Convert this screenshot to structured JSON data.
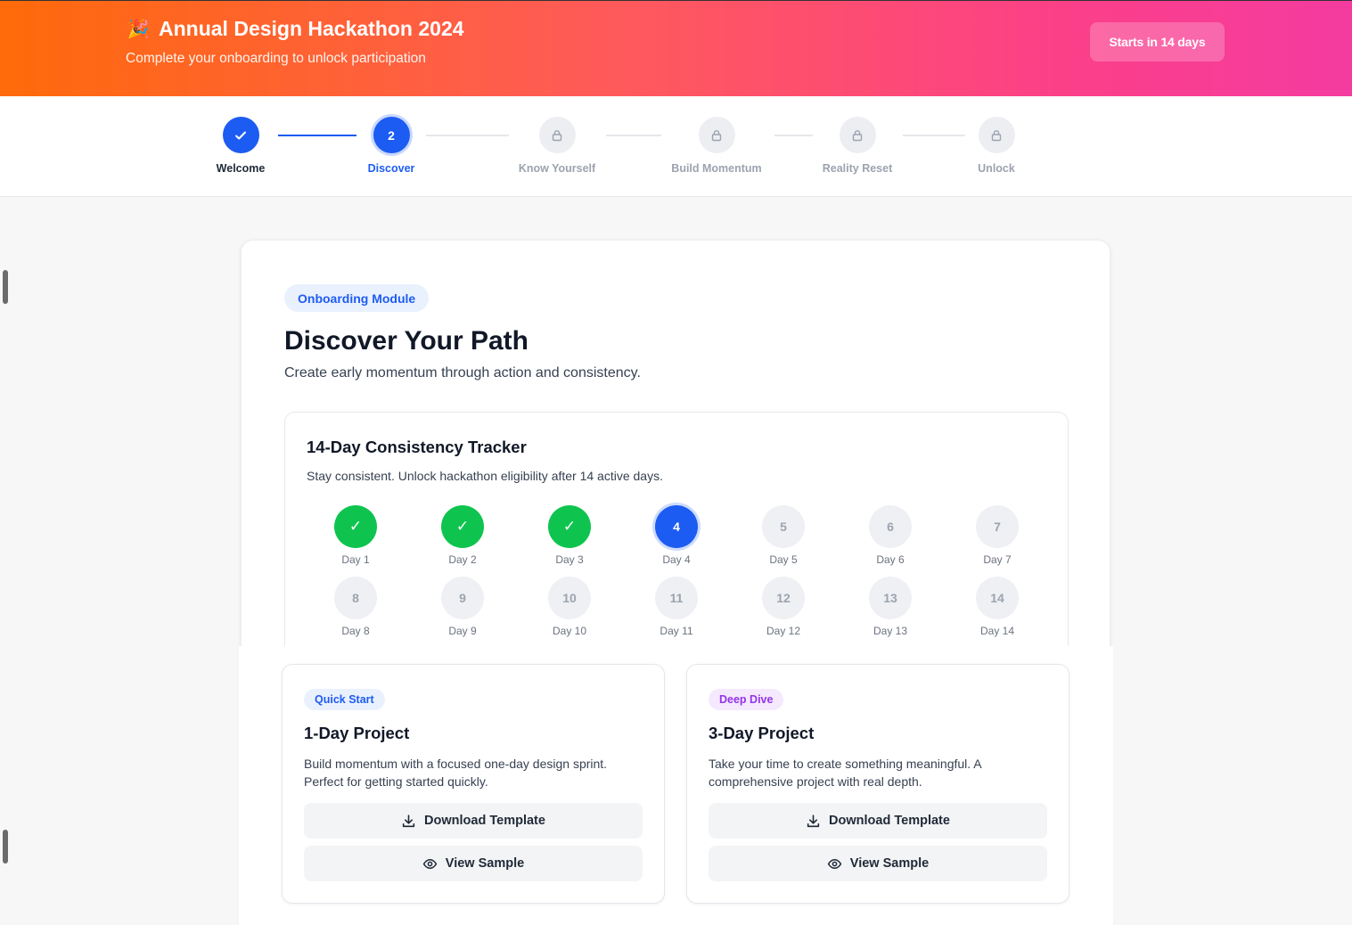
{
  "header": {
    "icon": "party-popper-icon",
    "title": "Annual Design Hackathon 2024",
    "subtitle": "Complete your onboarding to unlock participation",
    "starts_label": "Starts in 14 days"
  },
  "steps": [
    {
      "label": "Welcome",
      "state": "done",
      "symbol": "✓"
    },
    {
      "label": "Discover",
      "state": "active",
      "symbol": "2"
    },
    {
      "label": "Know Yourself",
      "state": "locked"
    },
    {
      "label": "Build Momentum",
      "state": "locked"
    },
    {
      "label": "Reality Reset",
      "state": "locked"
    },
    {
      "label": "Unlock",
      "state": "locked"
    }
  ],
  "module": {
    "tag": "Onboarding Module",
    "title": "Discover Your Path",
    "description": "Create early momentum through action and consistency."
  },
  "tracker": {
    "title": "14-Day Consistency Tracker",
    "description": "Stay consistent. Unlock hackathon eligibility after 14 active days.",
    "days": [
      {
        "num": "1",
        "label": "Day 1",
        "state": "done"
      },
      {
        "num": "2",
        "label": "Day 2",
        "state": "done"
      },
      {
        "num": "3",
        "label": "Day 3",
        "state": "done"
      },
      {
        "num": "4",
        "label": "Day 4",
        "state": "current"
      },
      {
        "num": "5",
        "label": "Day 5",
        "state": "future"
      },
      {
        "num": "6",
        "label": "Day 6",
        "state": "future"
      },
      {
        "num": "7",
        "label": "Day 7",
        "state": "future"
      },
      {
        "num": "8",
        "label": "Day 8",
        "state": "future"
      },
      {
        "num": "9",
        "label": "Day 9",
        "state": "future"
      },
      {
        "num": "10",
        "label": "Day 10",
        "state": "future"
      },
      {
        "num": "11",
        "label": "Day 11",
        "state": "future"
      },
      {
        "num": "12",
        "label": "Day 12",
        "state": "future"
      },
      {
        "num": "13",
        "label": "Day 13",
        "state": "future"
      },
      {
        "num": "14",
        "label": "Day 14",
        "state": "future"
      }
    ]
  },
  "projects": [
    {
      "tag": "Quick Start",
      "title": "1-Day Project",
      "description": "Build momentum with a focused one-day design sprint. Perfect for getting started quickly.",
      "download_label": "Download Template",
      "view_label": "View Sample"
    },
    {
      "tag": "Deep Dive",
      "title": "3-Day Project",
      "description": "Take your time to create something meaningful. A comprehensive project with real depth.",
      "download_label": "Download Template",
      "view_label": "View Sample"
    }
  ],
  "colors": {
    "primary": "#1d5cf2",
    "success": "#0ec44f",
    "header_gradient_start": "#ff6a0a",
    "header_gradient_end": "#f43ca0",
    "purple_tag": "#9333ea"
  }
}
